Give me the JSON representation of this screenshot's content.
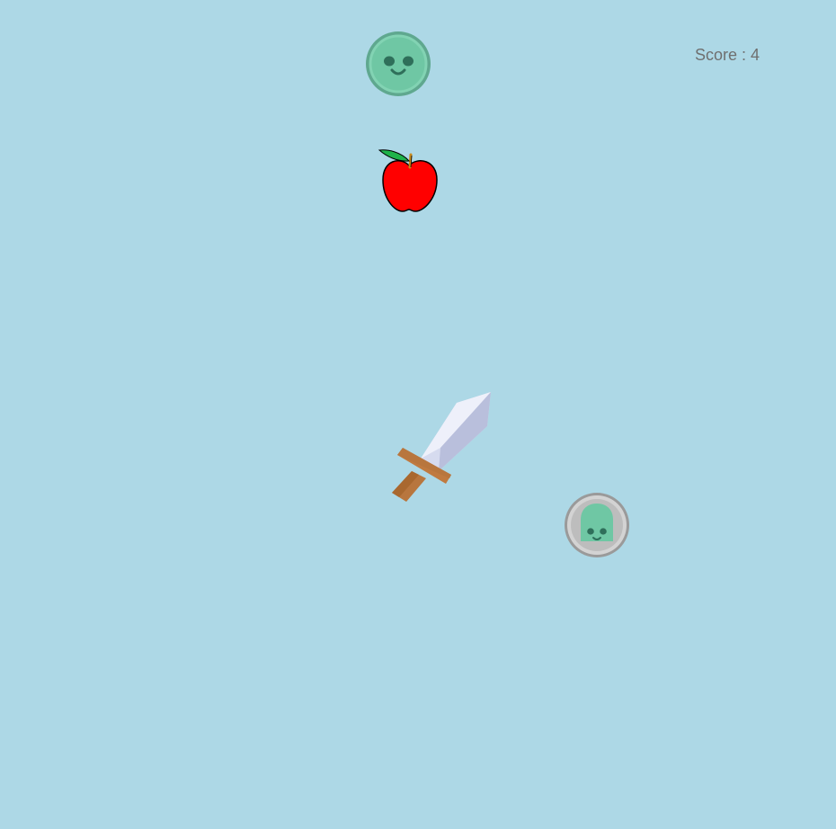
{
  "hud": {
    "score_text": "Score : 4",
    "score_value": 4
  },
  "objects": {
    "sprites": [
      {
        "name": "green-monster-coin",
        "type": "enemy"
      },
      {
        "name": "apple",
        "type": "fruit"
      },
      {
        "name": "sword",
        "type": "player"
      },
      {
        "name": "ghost-face-coin",
        "type": "enemy"
      }
    ]
  },
  "colors": {
    "background": "#ADD8E6",
    "score_text": "#6f6f6f",
    "apple_red": "#ff0000",
    "leaf_green": "#1fb34a",
    "monster_green": "#6fc7a4",
    "sword_blade": "#d6dbef",
    "sword_hilt": "#b8763e",
    "coin_silver": "#c8c8c8"
  }
}
